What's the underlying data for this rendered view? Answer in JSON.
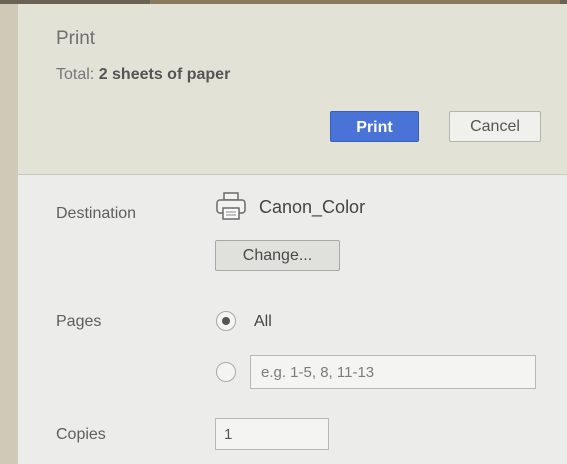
{
  "header": {
    "title": "Print",
    "summary_prefix": "Total: ",
    "summary_bold": "2 sheets of paper",
    "print_label": "Print",
    "cancel_label": "Cancel"
  },
  "destination": {
    "label": "Destination",
    "icon": "printer-icon",
    "printer_name": "Canon_Color",
    "change_label": "Change..."
  },
  "pages": {
    "label": "Pages",
    "option_all_label": "All",
    "option_all_selected": true,
    "custom_placeholder": "e.g. 1-5, 8, 11-13"
  },
  "copies": {
    "label": "Copies",
    "value": "1"
  },
  "colors": {
    "primary_button": "#4a73d8",
    "header_background": "#e2e3d6",
    "panel_background": "#ececea"
  }
}
